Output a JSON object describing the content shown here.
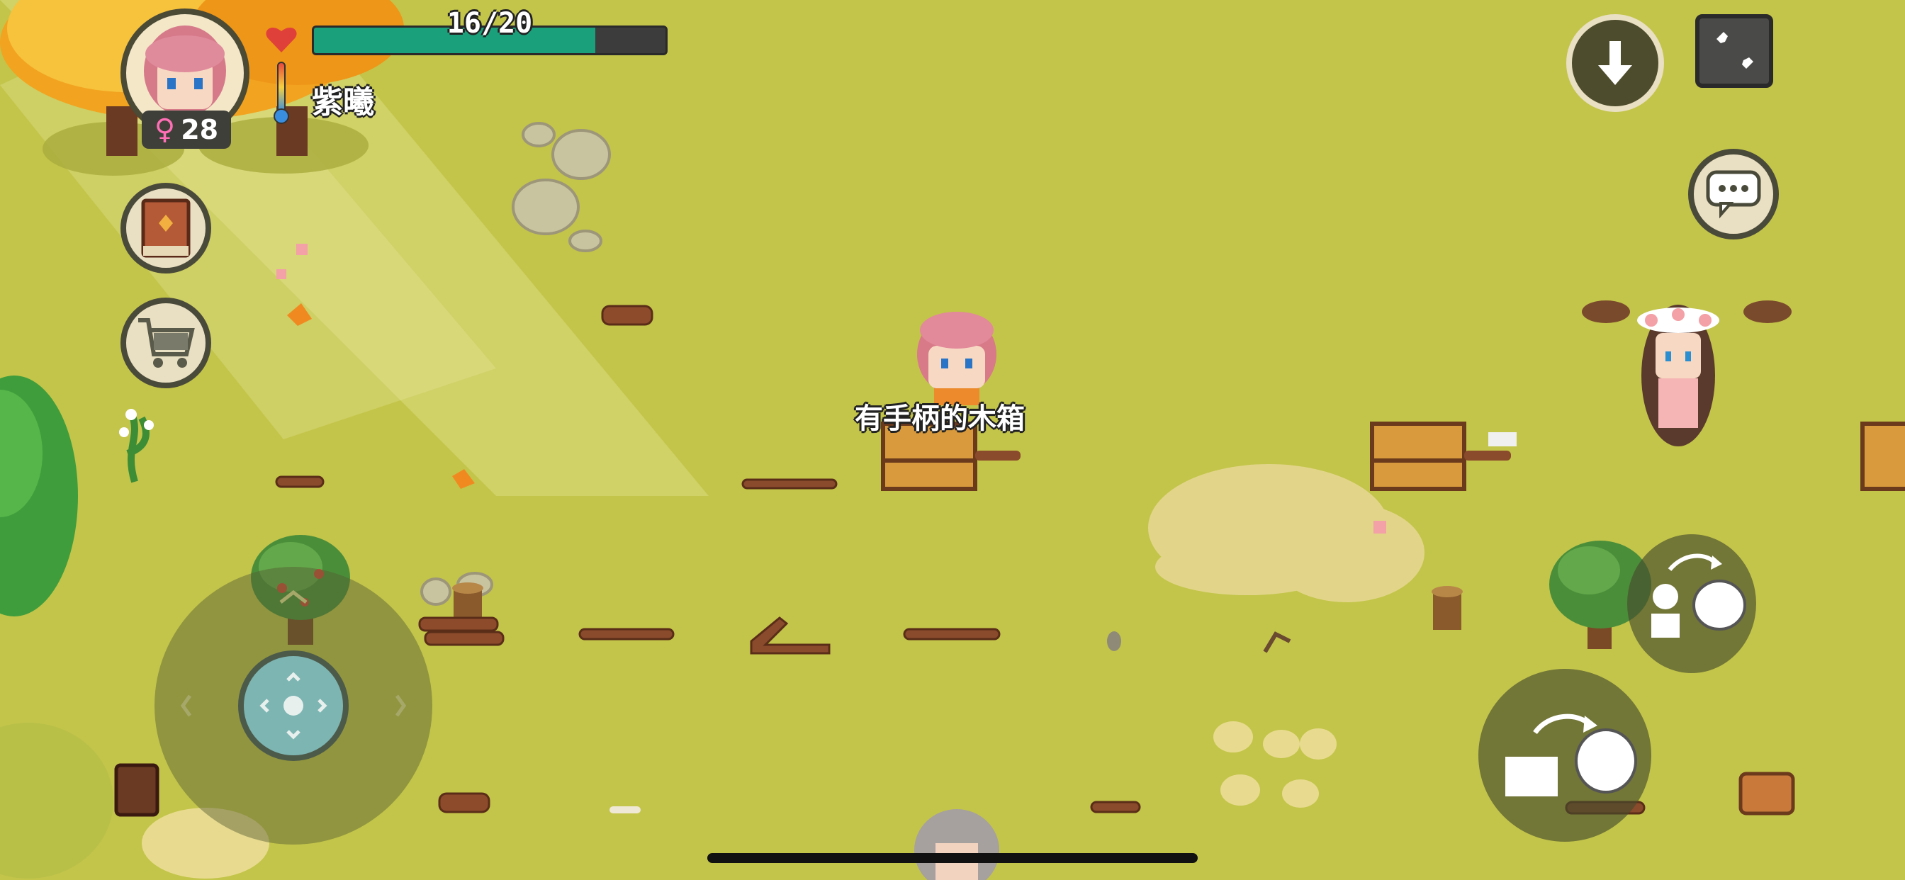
{
  "hud": {
    "hp_text": "16/20",
    "hp_fraction": 0.8,
    "player_name": "紫曦",
    "level": "28"
  },
  "world": {
    "item_label": "有手柄的木箱"
  },
  "icons": {
    "back": "down-arrow-icon",
    "settings": "wrench-icon",
    "chat": "speech-bubble-icon",
    "journal": "book-icon",
    "shop": "shopping-cart-icon"
  },
  "colors": {
    "grass": "#c3c54a",
    "hp_fill": "#1aa07a",
    "hp_bg": "#3c3c3c"
  }
}
